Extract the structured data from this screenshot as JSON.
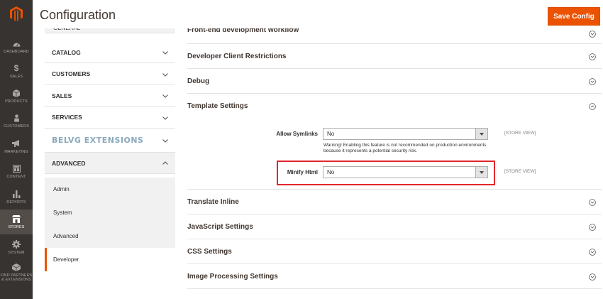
{
  "header": {
    "title": "Configuration",
    "save_label": "Save Config"
  },
  "admin_nav": [
    {
      "label": "DASHBOARD",
      "icon": "dashboard-icon"
    },
    {
      "label": "SALES",
      "icon": "dollar-icon"
    },
    {
      "label": "PRODUCTS",
      "icon": "cube-icon"
    },
    {
      "label": "CUSTOMERS",
      "icon": "person-icon"
    },
    {
      "label": "MARKETING",
      "icon": "megaphone-icon"
    },
    {
      "label": "CONTENT",
      "icon": "layout-icon"
    },
    {
      "label": "REPORTS",
      "icon": "bar-chart-icon"
    },
    {
      "label": "STORES",
      "icon": "store-icon",
      "active": true
    },
    {
      "label": "SYSTEM",
      "icon": "gear-icon"
    },
    {
      "label": "FIND PARTNERS & EXTENSIONS",
      "icon": "box-icon"
    }
  ],
  "config_sidebar": {
    "tabs": [
      "CATALOG",
      "CUSTOMERS",
      "SALES",
      "SERVICES",
      "BELVG EXTENSIONS",
      "ADVANCED"
    ],
    "advanced_links": [
      "Admin",
      "System",
      "Advanced",
      "Developer"
    ],
    "current_link": "Developer"
  },
  "sections": {
    "frontend_dev": "Front-end development workflow",
    "client_restrictions": "Developer Client Restrictions",
    "debug": "Debug",
    "template_settings": "Template Settings",
    "translate_inline": "Translate Inline",
    "javascript_settings": "JavaScript Settings",
    "css_settings": "CSS Settings",
    "image_processing": "Image Processing Settings"
  },
  "template_fields": {
    "allow_symlinks": {
      "label": "Allow Symlinks",
      "value": "No",
      "note": "Warning! Enabling this feature is not recommended on production environments because it represents a potential security risk.",
      "scope": "[STORE VIEW]"
    },
    "minify_html": {
      "label": "Minify Html",
      "value": "No",
      "scope": "[STORE VIEW]"
    }
  },
  "colors": {
    "accent": "#eb5202",
    "nav_bg": "#373330",
    "highlight": "#e3262d"
  }
}
